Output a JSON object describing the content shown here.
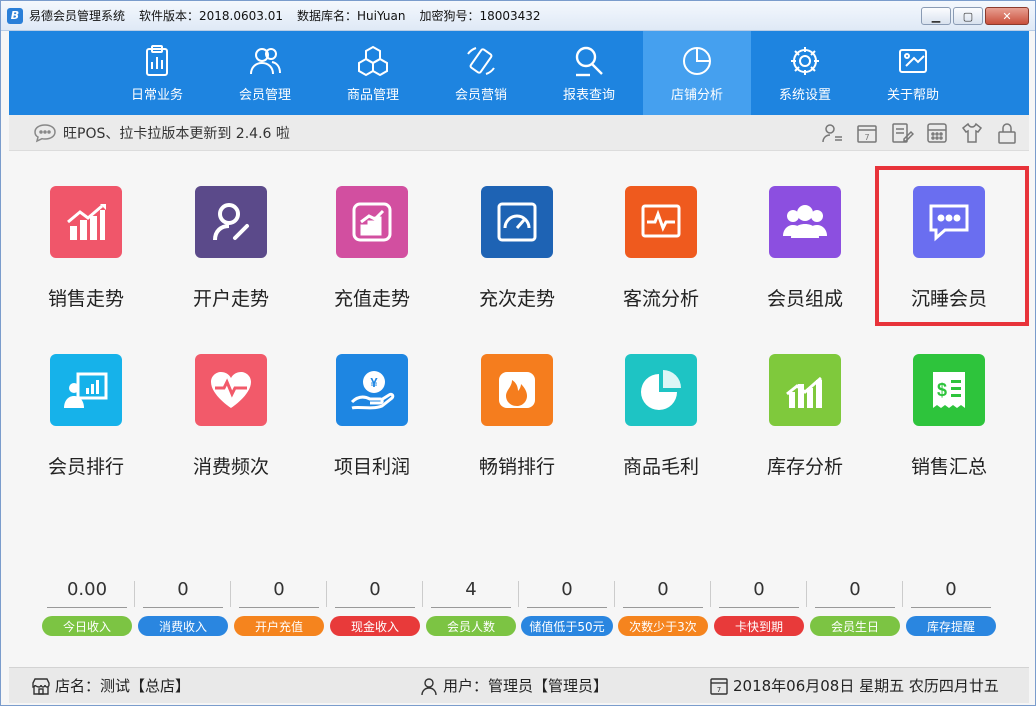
{
  "titlebar": {
    "app_title": "易德会员管理系统",
    "version": "软件版本：2018.0603.01",
    "database": "数据库名：HuiYuan",
    "dongle": "加密狗号：18003432"
  },
  "nav": {
    "items": [
      {
        "label": "日常业务",
        "icon": "clipboard-icon"
      },
      {
        "label": "会员管理",
        "icon": "members-icon"
      },
      {
        "label": "商品管理",
        "icon": "cubes-icon"
      },
      {
        "label": "会员营销",
        "icon": "phone-icon"
      },
      {
        "label": "报表查询",
        "icon": "search-report-icon"
      },
      {
        "label": "店铺分析",
        "icon": "pie-chart-icon"
      },
      {
        "label": "系统设置",
        "icon": "gear-icon"
      },
      {
        "label": "关于帮助",
        "icon": "help-icon"
      }
    ],
    "active_index": 5
  },
  "notice": {
    "text": "旺POS、拉卡拉版本更新到 2.4.6 啦"
  },
  "tiles": [
    {
      "label": "销售走势",
      "color": "#f0566a"
    },
    {
      "label": "开户走势",
      "color": "#5b4a8a"
    },
    {
      "label": "充值走势",
      "color": "#d24fa0"
    },
    {
      "label": "充次走势",
      "color": "#1e63b4"
    },
    {
      "label": "客流分析",
      "color": "#ef5a1e"
    },
    {
      "label": "会员组成",
      "color": "#8c4fe0"
    },
    {
      "label": "沉睡会员",
      "color": "#6a6ef0"
    },
    {
      "label": "会员排行",
      "color": "#16b2ea"
    },
    {
      "label": "消费频次",
      "color": "#f25a6a"
    },
    {
      "label": "项目利润",
      "color": "#1e86e2"
    },
    {
      "label": "畅销排行",
      "color": "#f57d1e"
    },
    {
      "label": "商品毛利",
      "color": "#1ec4c4"
    },
    {
      "label": "库存分析",
      "color": "#7fc93c"
    },
    {
      "label": "销售汇总",
      "color": "#2ec43c"
    }
  ],
  "stats": [
    {
      "value": "0.00",
      "label": "今日收入",
      "color": "#7cc443"
    },
    {
      "value": "0",
      "label": "消费收入",
      "color": "#2a86e0"
    },
    {
      "value": "0",
      "label": "开户充值",
      "color": "#f5841e"
    },
    {
      "value": "0",
      "label": "现金收入",
      "color": "#e83a3a"
    },
    {
      "value": "4",
      "label": "会员人数",
      "color": "#7cc443"
    },
    {
      "value": "0",
      "label": "储值低于50元",
      "color": "#2a86e0"
    },
    {
      "value": "0",
      "label": "次数少于3次",
      "color": "#f5841e"
    },
    {
      "value": "0",
      "label": "卡快到期",
      "color": "#e83a3a"
    },
    {
      "value": "0",
      "label": "会员生日",
      "color": "#7cc443"
    },
    {
      "value": "0",
      "label": "库存提醒",
      "color": "#2a86e0"
    }
  ],
  "statusbar": {
    "store": "店名：测试【总店】",
    "user": "用户：管理员【管理员】",
    "date": "2018年06月08日 星期五 农历四月廿五"
  }
}
